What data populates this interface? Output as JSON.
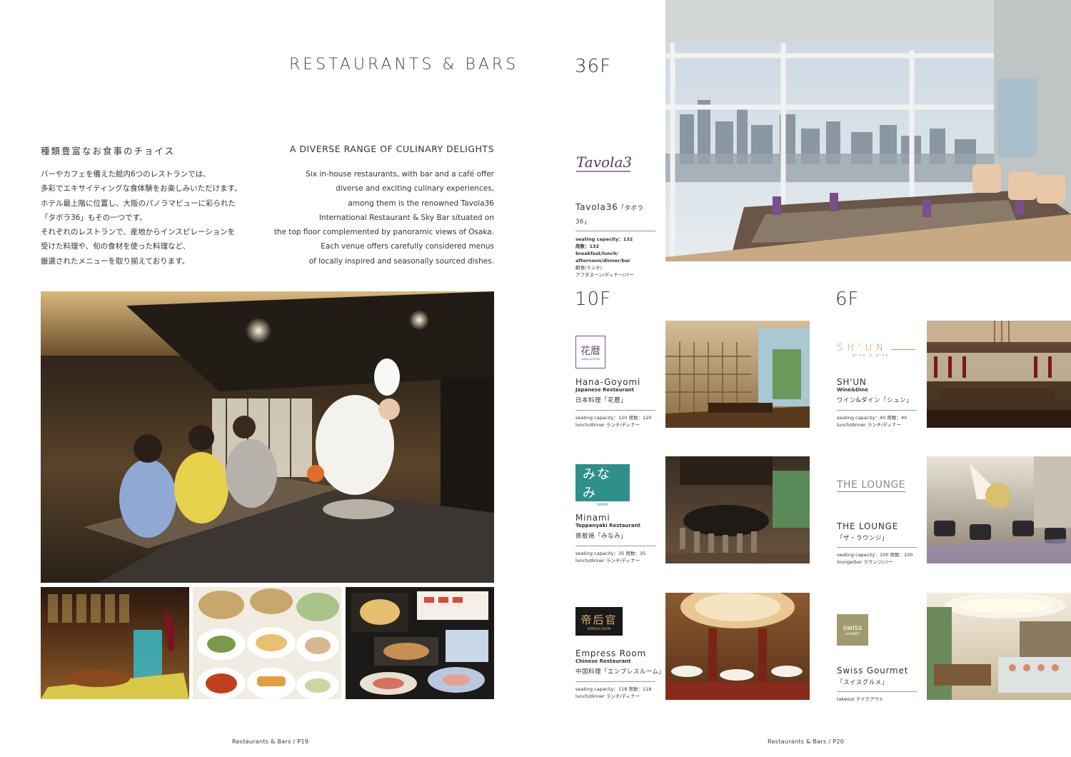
{
  "left_page": {
    "title": "RESTAURANTS & BARS",
    "jp_heading": "種類豊富なお食事のチョイス",
    "en_heading": "A DIVERSE RANGE OF CULINARY DELIGHTS",
    "jp_body": [
      "バーやカフェを備えた館内6つのレストランでは、",
      "多彩でエキサイティングな食体験をお楽しみいただけます。",
      "ホテル最上階に位置し、大阪のパノラマビューに彩られた",
      "「タボラ36」もその一つです。",
      "それぞれのレストランで、産地からインスピレーションを",
      "受けた料理や、旬の食材を使った料理など、",
      "厳選されたメニューを取り揃えております。"
    ],
    "en_body": [
      "Six in-house restaurants, with bar and a café offer",
      "diverse and exciting culinary experiences,",
      "among them is the renowned Tavola36",
      "International Restaurant & Sky Bar situated on",
      "the top floor complemented by panoramic views of Osaka.",
      "Each venue offers carefully considered menus",
      "of locally inspired and seasonally sourced dishes."
    ],
    "footer": "Restaurants & Bars / P19"
  },
  "right_page": {
    "floor_36": "36F",
    "floor_10": "10F",
    "floor_6": "6F",
    "footer": "Restaurants & Bars / P20",
    "tavola": {
      "logo": "Tavola36",
      "name": "Tavola36",
      "jp": "「タボラ36」",
      "details": [
        "seating capacity：132",
        "席数：132",
        "breakfast/lunch/",
        "afternoon/dinner/bar",
        "朝食/ランチ/",
        "アフタヌーン/ディナー/バー"
      ]
    },
    "hana": {
      "logo": "花暦",
      "logo_sub": "HANA-GOYOMI",
      "name": "Hana-Goyomi",
      "type": "Japanese Restaurant",
      "jp": "日本料理「花暦」",
      "details": [
        "seating capacity：120 席数：120",
        "lunch/dinner ランチ/ディナー"
      ]
    },
    "minami": {
      "logo": "みなみ",
      "logo_sub": "MINAMI",
      "name": "Minami",
      "type": "Teppanyaki Restaurant",
      "jp": "鉄板焼「みなみ」",
      "details": [
        "seating capacity：35 席数：35",
        "lunch/dinner ランチ/ディナー"
      ]
    },
    "empress": {
      "logo": "帝后官",
      "logo_sub": "EMPRESS ROOM",
      "name": "Empress Room",
      "type": "Chinese Restaurant",
      "jp": "中国料理「エンプレスルーム」",
      "details": [
        "seating capacity：118 席数：118",
        "lunch/dinner ランチ/ディナー"
      ]
    },
    "shun": {
      "logo": "SH'UN",
      "logo_sub": "wine & dine",
      "name": "SH'UN",
      "type": "Wine&Dine",
      "jp": "ワイン&ダイン「シュン」",
      "details": [
        "seating capacity：40 席数：40",
        "lunch/dinner ランチ/ディナー"
      ]
    },
    "lounge": {
      "logo": "THE LOUNGE",
      "name": "THE LOUNGE",
      "jp": "「ザ・ラウンジ」",
      "details": [
        "seating capacity：100 席数：100",
        "lounge/bar ラウンジ/バー"
      ]
    },
    "swiss": {
      "logo": "swiss",
      "logo_sub": "GOURMET",
      "name": "Swiss Gourmet",
      "jp": "「スイスグルメ」",
      "details": [
        "takeout テイクアウト"
      ]
    }
  },
  "colors": {
    "tavola_purple": "#5a3566",
    "shun_orange": "#d9894a",
    "lounge_gray": "#8a8a8a",
    "swiss_olive": "#a19a6e",
    "minami_teal": "#2f8f8a"
  }
}
